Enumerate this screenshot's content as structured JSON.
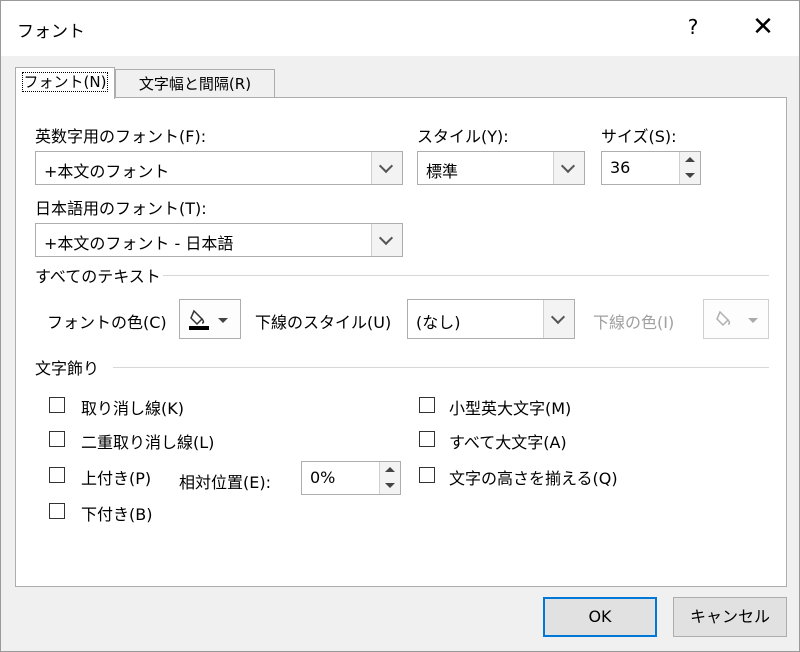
{
  "window": {
    "title": "フォント",
    "help": "?",
    "close": "✕"
  },
  "tabs": [
    {
      "label": "フォント(N)",
      "active": true
    },
    {
      "label": "文字幅と間隔(R)",
      "active": false
    }
  ],
  "fonts": {
    "latin_label": "英数字用のフォント(F):",
    "latin_value": "+本文のフォント",
    "style_label": "スタイル(Y):",
    "style_value": "標準",
    "size_label": "サイズ(S):",
    "size_value": "36",
    "japanese_label": "日本語用のフォント(T):",
    "japanese_value": "+本文のフォント - 日本語"
  },
  "all_text": {
    "section": "すべてのテキスト",
    "font_color_label": "フォントの色(C)",
    "underline_style_label": "下線のスタイル(U)",
    "underline_style_value": "(なし)",
    "underline_color_label": "下線の色(I)"
  },
  "effects": {
    "section": "文字飾り",
    "strikethrough": "取り消し線(K)",
    "double_strikethrough": "二重取り消し線(L)",
    "superscript": "上付き(P)",
    "offset_label": "相対位置(E):",
    "offset_value": "0%",
    "subscript": "下付き(B)",
    "small_caps": "小型英大文字(M)",
    "all_caps": "すべて大文字(A)",
    "equalize_height": "文字の高さを揃える(Q)"
  },
  "buttons": {
    "ok": "OK",
    "cancel": "キャンセル"
  }
}
